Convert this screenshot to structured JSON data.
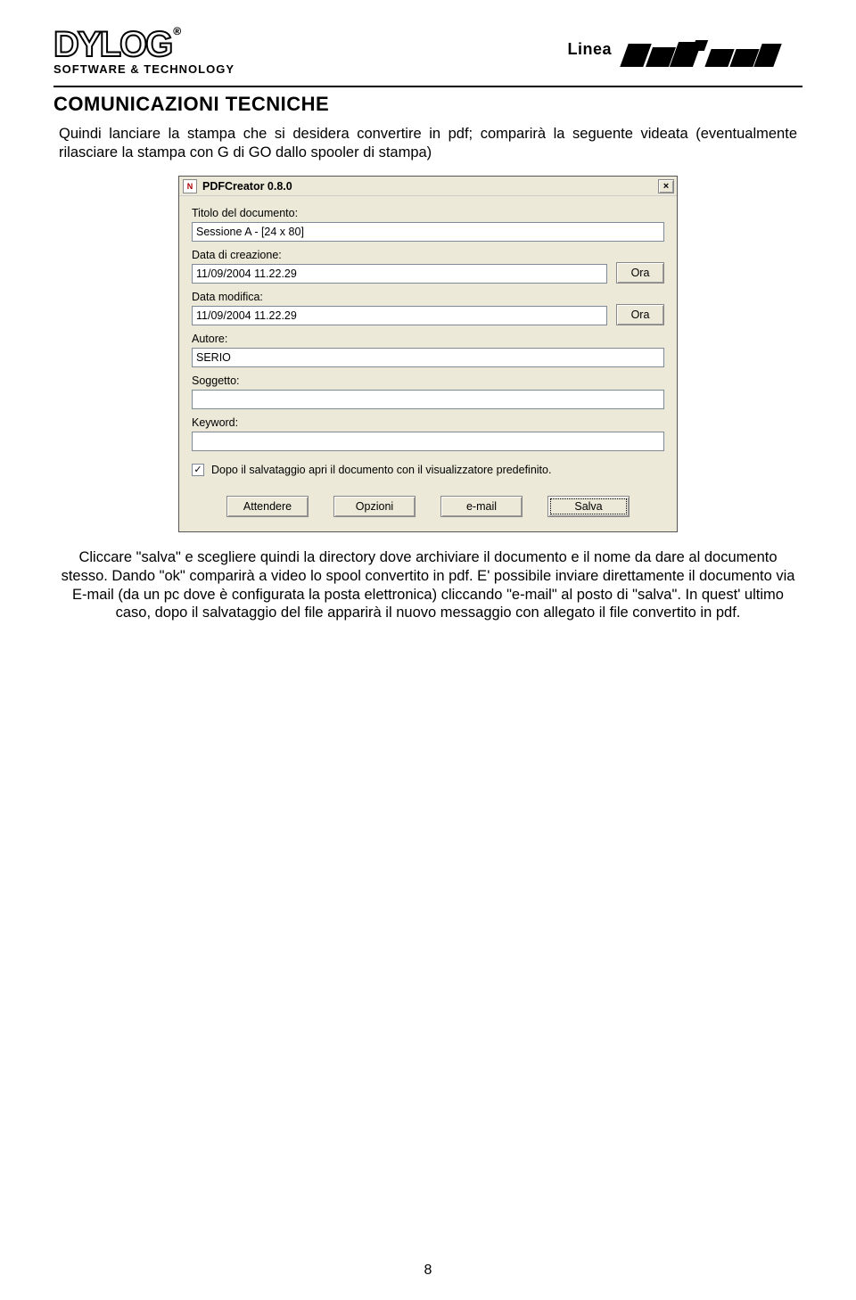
{
  "header": {
    "brand_name": "DYLOG",
    "brand_tagline": "SOFTWARE & TECHNOLOGY",
    "linea_label": "Linea",
    "linea_brand": "PRASSI"
  },
  "section_title": "COMUNICAZIONI TECNICHE",
  "intro_paragraph": "Quindi lanciare la stampa che si desidera convertire in pdf; comparirà la seguente videata (eventualmente rilasciare la stampa con G di GO dallo spooler di stampa)",
  "dialog": {
    "title": "PDFCreator 0.8.0",
    "close_label": "×",
    "fields": {
      "titolo_label": "Titolo del documento:",
      "titolo_value": "Sessione A - [24 x 80]",
      "creazione_label": "Data di creazione:",
      "creazione_value": "11/09/2004 11.22.29",
      "modifica_label": "Data modifica:",
      "modifica_value": "11/09/2004 11.22.29",
      "autore_label": "Autore:",
      "autore_value": "SERIO",
      "soggetto_label": "Soggetto:",
      "soggetto_value": "",
      "keyword_label": "Keyword:",
      "keyword_value": "",
      "ora_button": "Ora"
    },
    "checkbox_label": "Dopo il salvataggio apri il documento con il visualizzatore predefinito.",
    "checkbox_checked": true,
    "buttons": {
      "attendere": "Attendere",
      "opzioni": "Opzioni",
      "email": "e-mail",
      "salva": "Salva"
    }
  },
  "outro_paragraph": "Cliccare \"salva\" e scegliere quindi la directory dove archiviare il documento e il nome da dare al documento stesso. Dando \"ok\" comparirà a video lo spool convertito in pdf. E' possibile inviare direttamente il documento via E-mail (da un pc dove è configurata la posta elettronica) cliccando \"e-mail\" al posto di \"salva\". In quest' ultimo caso, dopo il salvataggio del file apparirà il nuovo messaggio con allegato il file convertito in pdf.",
  "page_number": "8"
}
